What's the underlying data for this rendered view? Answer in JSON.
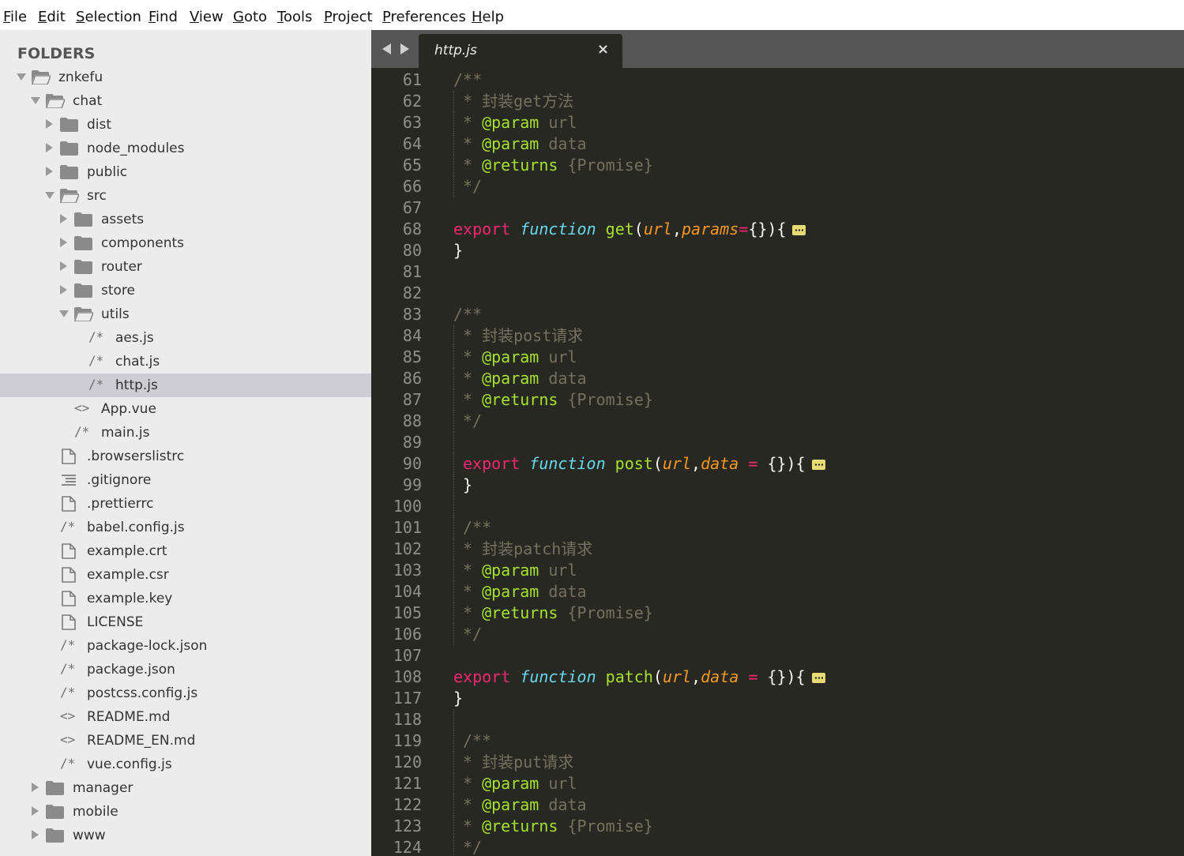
{
  "menu": [
    "File",
    "Edit",
    "Selection",
    "Find",
    "View",
    "Goto",
    "Tools",
    "Project",
    "Preferences",
    "Help"
  ],
  "sidebar": {
    "title": "FOLDERS",
    "items": [
      {
        "label": "znkefu",
        "depth": 0,
        "kind": "folder",
        "state": "open",
        "icon": "folder-open-icon"
      },
      {
        "label": "chat",
        "depth": 1,
        "kind": "folder",
        "state": "open",
        "icon": "folder-open-icon"
      },
      {
        "label": "dist",
        "depth": 2,
        "kind": "folder",
        "state": "closed",
        "icon": "folder-icon"
      },
      {
        "label": "node_modules",
        "depth": 2,
        "kind": "folder",
        "state": "closed",
        "icon": "folder-icon"
      },
      {
        "label": "public",
        "depth": 2,
        "kind": "folder",
        "state": "closed",
        "icon": "folder-icon"
      },
      {
        "label": "src",
        "depth": 2,
        "kind": "folder",
        "state": "open",
        "icon": "folder-open-icon"
      },
      {
        "label": "assets",
        "depth": 3,
        "kind": "folder",
        "state": "closed",
        "icon": "folder-icon"
      },
      {
        "label": "components",
        "depth": 3,
        "kind": "folder",
        "state": "closed",
        "icon": "folder-icon"
      },
      {
        "label": "router",
        "depth": 3,
        "kind": "folder",
        "state": "closed",
        "icon": "folder-icon"
      },
      {
        "label": "store",
        "depth": 3,
        "kind": "folder",
        "state": "closed",
        "icon": "folder-icon"
      },
      {
        "label": "utils",
        "depth": 3,
        "kind": "folder",
        "state": "open",
        "icon": "folder-open-icon"
      },
      {
        "label": "aes.js",
        "depth": 4,
        "kind": "file",
        "glyph": "/*",
        "icon": "js-file-icon"
      },
      {
        "label": "chat.js",
        "depth": 4,
        "kind": "file",
        "glyph": "/*",
        "icon": "js-file-icon"
      },
      {
        "label": "http.js",
        "depth": 4,
        "kind": "file",
        "glyph": "/*",
        "icon": "js-file-icon",
        "selected": true
      },
      {
        "label": "App.vue",
        "depth": 3,
        "kind": "file",
        "glyph": "<>",
        "icon": "markup-file-icon"
      },
      {
        "label": "main.js",
        "depth": 3,
        "kind": "file",
        "glyph": "/*",
        "icon": "js-file-icon"
      },
      {
        "label": ".browserslistrc",
        "depth": 2,
        "kind": "doc",
        "icon": "file-icon"
      },
      {
        "label": ".gitignore",
        "depth": 2,
        "kind": "lines",
        "icon": "lines-file-icon"
      },
      {
        "label": ".prettierrc",
        "depth": 2,
        "kind": "doc",
        "icon": "file-icon"
      },
      {
        "label": "babel.config.js",
        "depth": 2,
        "kind": "file",
        "glyph": "/*",
        "icon": "js-file-icon"
      },
      {
        "label": "example.crt",
        "depth": 2,
        "kind": "doc",
        "icon": "file-icon"
      },
      {
        "label": "example.csr",
        "depth": 2,
        "kind": "doc",
        "icon": "file-icon"
      },
      {
        "label": "example.key",
        "depth": 2,
        "kind": "doc",
        "icon": "file-icon"
      },
      {
        "label": "LICENSE",
        "depth": 2,
        "kind": "doc",
        "icon": "file-icon"
      },
      {
        "label": "package-lock.json",
        "depth": 2,
        "kind": "file",
        "glyph": "/*",
        "icon": "json-file-icon"
      },
      {
        "label": "package.json",
        "depth": 2,
        "kind": "file",
        "glyph": "/*",
        "icon": "json-file-icon"
      },
      {
        "label": "postcss.config.js",
        "depth": 2,
        "kind": "file",
        "glyph": "/*",
        "icon": "js-file-icon"
      },
      {
        "label": "README.md",
        "depth": 2,
        "kind": "file",
        "glyph": "<>",
        "icon": "markup-file-icon"
      },
      {
        "label": "README_EN.md",
        "depth": 2,
        "kind": "file",
        "glyph": "<>",
        "icon": "markup-file-icon"
      },
      {
        "label": "vue.config.js",
        "depth": 2,
        "kind": "file",
        "glyph": "/*",
        "icon": "js-file-icon"
      },
      {
        "label": "manager",
        "depth": 1,
        "kind": "folder",
        "state": "closed",
        "icon": "folder-icon"
      },
      {
        "label": "mobile",
        "depth": 1,
        "kind": "folder",
        "state": "closed",
        "icon": "folder-icon"
      },
      {
        "label": "www",
        "depth": 1,
        "kind": "folder",
        "state": "closed",
        "icon": "folder-icon"
      }
    ]
  },
  "tabs": [
    {
      "label": "http.js",
      "active": true
    }
  ],
  "tab_close": "×",
  "code": [
    {
      "n": "61",
      "indent": 0,
      "guide": false,
      "parts": [
        [
          "c",
          "/**"
        ]
      ]
    },
    {
      "n": "62",
      "indent": 1,
      "guide": true,
      "parts": [
        [
          "c",
          "* 封装get方法"
        ]
      ]
    },
    {
      "n": "63",
      "indent": 1,
      "guide": true,
      "parts": [
        [
          "c",
          "* "
        ],
        [
          "ct",
          "@param"
        ],
        [
          "c",
          " url"
        ]
      ]
    },
    {
      "n": "64",
      "indent": 1,
      "guide": true,
      "parts": [
        [
          "c",
          "* "
        ],
        [
          "ct",
          "@param"
        ],
        [
          "c",
          " data"
        ]
      ]
    },
    {
      "n": "65",
      "indent": 1,
      "guide": true,
      "parts": [
        [
          "c",
          "* "
        ],
        [
          "ct",
          "@returns"
        ],
        [
          "c",
          " {Promise}"
        ]
      ]
    },
    {
      "n": "66",
      "indent": 1,
      "guide": true,
      "parts": [
        [
          "c",
          "*/"
        ]
      ]
    },
    {
      "n": "67",
      "indent": 0,
      "guide": false,
      "parts": []
    },
    {
      "n": "68",
      "indent": 0,
      "guide": false,
      "fold": true,
      "parts": [
        [
          "kw",
          "export"
        ],
        [
          "pl",
          " "
        ],
        [
          "st",
          "function"
        ],
        [
          "pl",
          " "
        ],
        [
          "fn",
          "get"
        ],
        [
          "pl",
          "("
        ],
        [
          "pr",
          "url"
        ],
        [
          "pl",
          ","
        ],
        [
          "pr",
          "params"
        ],
        [
          "op",
          "="
        ],
        [
          "pl",
          "{}){"
        ]
      ]
    },
    {
      "n": "80",
      "indent": 0,
      "guide": false,
      "parts": [
        [
          "pl",
          "}"
        ]
      ]
    },
    {
      "n": "81",
      "indent": 0,
      "guide": false,
      "parts": []
    },
    {
      "n": "82",
      "indent": 0,
      "guide": false,
      "parts": []
    },
    {
      "n": "83",
      "indent": 0,
      "guide": false,
      "parts": [
        [
          "c",
          "/**"
        ]
      ]
    },
    {
      "n": "84",
      "indent": 1,
      "guide": true,
      "parts": [
        [
          "c",
          "* 封装post请求"
        ]
      ]
    },
    {
      "n": "85",
      "indent": 1,
      "guide": true,
      "parts": [
        [
          "c",
          "* "
        ],
        [
          "ct",
          "@param"
        ],
        [
          "c",
          " url"
        ]
      ]
    },
    {
      "n": "86",
      "indent": 1,
      "guide": true,
      "parts": [
        [
          "c",
          "* "
        ],
        [
          "ct",
          "@param"
        ],
        [
          "c",
          " data"
        ]
      ]
    },
    {
      "n": "87",
      "indent": 1,
      "guide": true,
      "parts": [
        [
          "c",
          "* "
        ],
        [
          "ct",
          "@returns"
        ],
        [
          "c",
          " {Promise}"
        ]
      ]
    },
    {
      "n": "88",
      "indent": 1,
      "guide": true,
      "parts": [
        [
          "c",
          "*/"
        ]
      ]
    },
    {
      "n": "89",
      "indent": 0,
      "guide": true,
      "parts": []
    },
    {
      "n": "90",
      "indent": 1,
      "guide": true,
      "fold": true,
      "parts": [
        [
          "kw",
          "export"
        ],
        [
          "pl",
          " "
        ],
        [
          "st",
          "function"
        ],
        [
          "pl",
          " "
        ],
        [
          "fn",
          "post"
        ],
        [
          "pl",
          "("
        ],
        [
          "pr",
          "url"
        ],
        [
          "pl",
          ","
        ],
        [
          "pr",
          "data"
        ],
        [
          "pl",
          " "
        ],
        [
          "op",
          "="
        ],
        [
          "pl",
          " {}){"
        ]
      ]
    },
    {
      "n": "99",
      "indent": 1,
      "guide": true,
      "parts": [
        [
          "pl",
          "}"
        ]
      ]
    },
    {
      "n": "100",
      "indent": 0,
      "guide": true,
      "parts": []
    },
    {
      "n": "101",
      "indent": 1,
      "guide": true,
      "parts": [
        [
          "c",
          "/**"
        ]
      ]
    },
    {
      "n": "102",
      "indent": 1,
      "guide": true,
      "parts": [
        [
          "c",
          "* 封装patch请求"
        ]
      ]
    },
    {
      "n": "103",
      "indent": 1,
      "guide": true,
      "parts": [
        [
          "c",
          "* "
        ],
        [
          "ct",
          "@param"
        ],
        [
          "c",
          " url"
        ]
      ]
    },
    {
      "n": "104",
      "indent": 1,
      "guide": true,
      "parts": [
        [
          "c",
          "* "
        ],
        [
          "ct",
          "@param"
        ],
        [
          "c",
          " data"
        ]
      ]
    },
    {
      "n": "105",
      "indent": 1,
      "guide": true,
      "parts": [
        [
          "c",
          "* "
        ],
        [
          "ct",
          "@returns"
        ],
        [
          "c",
          " {Promise}"
        ]
      ]
    },
    {
      "n": "106",
      "indent": 1,
      "guide": true,
      "parts": [
        [
          "c",
          "*/"
        ]
      ]
    },
    {
      "n": "107",
      "indent": 0,
      "guide": false,
      "parts": []
    },
    {
      "n": "108",
      "indent": 0,
      "guide": false,
      "fold": true,
      "parts": [
        [
          "kw",
          "export"
        ],
        [
          "pl",
          " "
        ],
        [
          "st",
          "function"
        ],
        [
          "pl",
          " "
        ],
        [
          "fn",
          "patch"
        ],
        [
          "pl",
          "("
        ],
        [
          "pr",
          "url"
        ],
        [
          "pl",
          ","
        ],
        [
          "pr",
          "data"
        ],
        [
          "pl",
          " "
        ],
        [
          "op",
          "="
        ],
        [
          "pl",
          " {}){"
        ]
      ]
    },
    {
      "n": "117",
      "indent": 0,
      "guide": false,
      "parts": [
        [
          "pl",
          "}"
        ]
      ]
    },
    {
      "n": "118",
      "indent": 0,
      "guide": true,
      "parts": []
    },
    {
      "n": "119",
      "indent": 1,
      "guide": true,
      "parts": [
        [
          "c",
          "/**"
        ]
      ]
    },
    {
      "n": "120",
      "indent": 1,
      "guide": true,
      "parts": [
        [
          "c",
          "* 封装put请求"
        ]
      ]
    },
    {
      "n": "121",
      "indent": 1,
      "guide": true,
      "parts": [
        [
          "c",
          "* "
        ],
        [
          "ct",
          "@param"
        ],
        [
          "c",
          " url"
        ]
      ]
    },
    {
      "n": "122",
      "indent": 1,
      "guide": true,
      "parts": [
        [
          "c",
          "* "
        ],
        [
          "ct",
          "@param"
        ],
        [
          "c",
          " data"
        ]
      ]
    },
    {
      "n": "123",
      "indent": 1,
      "guide": true,
      "parts": [
        [
          "c",
          "* "
        ],
        [
          "ct",
          "@returns"
        ],
        [
          "c",
          " {Promise}"
        ]
      ]
    },
    {
      "n": "124",
      "indent": 1,
      "guide": true,
      "parts": [
        [
          "c",
          "*/"
        ]
      ]
    }
  ]
}
